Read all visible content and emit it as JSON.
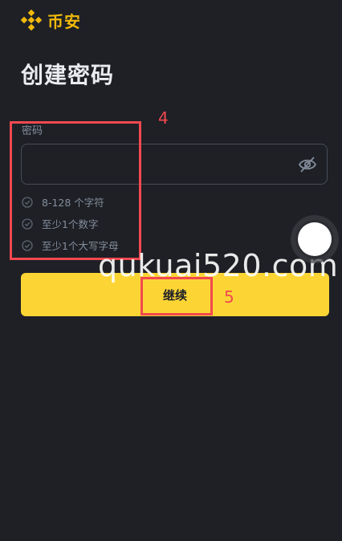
{
  "brand": {
    "name": "币安",
    "accent": "#f0b90b"
  },
  "page": {
    "title": "创建密码"
  },
  "password": {
    "label": "密码",
    "value": "",
    "visibility_icon": "eye-off-icon"
  },
  "requirements": [
    {
      "text": "8-128 个字符",
      "icon": "check-circle-icon"
    },
    {
      "text": "至少1个数字",
      "icon": "check-circle-icon"
    },
    {
      "text": "至少1个大写字母",
      "icon": "check-circle-icon"
    }
  ],
  "continue_button": {
    "label": "继续",
    "color": "#fcd535"
  },
  "annotations": [
    {
      "number": "4",
      "color": "#f2494f"
    },
    {
      "number": "5",
      "color": "#f2494f"
    }
  ],
  "watermark": {
    "text": "qukuai520.com"
  },
  "floating_button": {
    "icon": "assistive-touch-icon"
  }
}
